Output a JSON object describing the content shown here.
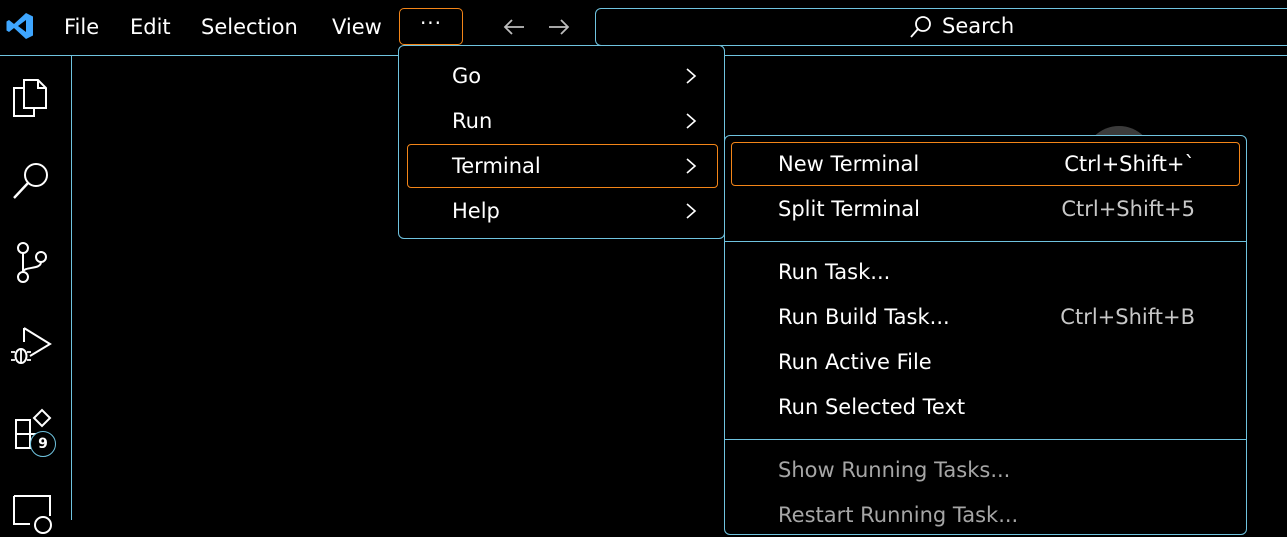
{
  "titlebar": {
    "menus": [
      "File",
      "Edit",
      "Selection",
      "View"
    ],
    "more_label": "···",
    "search_label": "Search"
  },
  "activitybar": {
    "extensions_badge": "9"
  },
  "more_menu": {
    "items": [
      {
        "label": "Go"
      },
      {
        "label": "Run"
      },
      {
        "label": "Terminal"
      },
      {
        "label": "Help"
      }
    ]
  },
  "terminal_menu": {
    "items": [
      {
        "label": "New Terminal",
        "shortcut": "Ctrl+Shift+`"
      },
      {
        "label": "Split Terminal",
        "shortcut": "Ctrl+Shift+5"
      },
      {
        "label": "Run Task...",
        "shortcut": ""
      },
      {
        "label": "Run Build Task...",
        "shortcut": "Ctrl+Shift+B"
      },
      {
        "label": "Run Active File",
        "shortcut": ""
      },
      {
        "label": "Run Selected Text",
        "shortcut": ""
      },
      {
        "label": "Show Running Tasks...",
        "shortcut": ""
      },
      {
        "label": "Restart Running Task...",
        "shortcut": ""
      }
    ]
  },
  "colors": {
    "background": "#000000",
    "contrast_border": "#6fc3df",
    "focus_border": "#f38518",
    "logo_blue": "#3ea6ff"
  }
}
